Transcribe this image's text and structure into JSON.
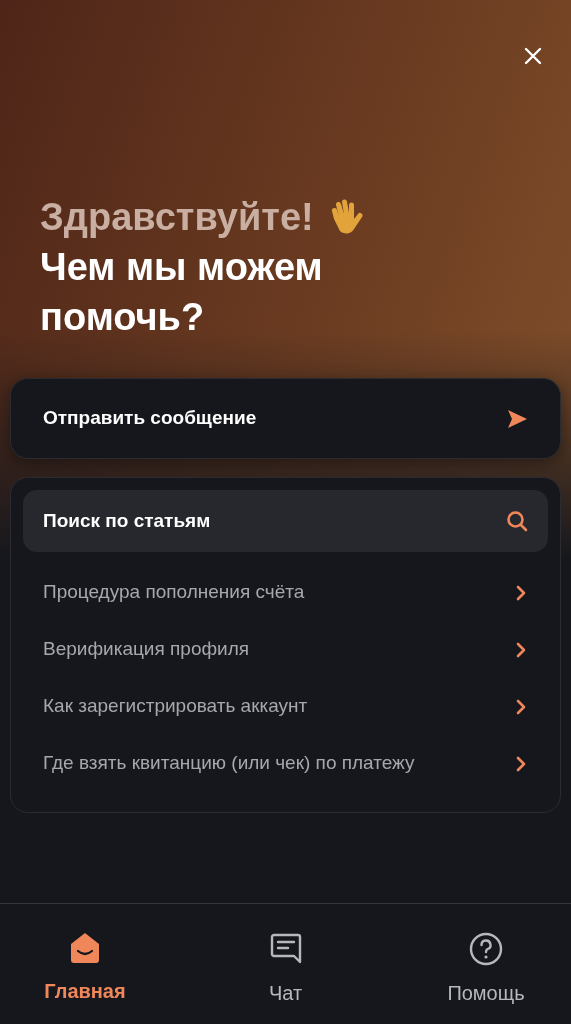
{
  "greeting": "Здравствуйте!",
  "heading": "Чем мы можем помочь?",
  "send_message": {
    "label": "Отправить сообщение"
  },
  "search": {
    "placeholder": "Поиск по статьям"
  },
  "articles": [
    {
      "title": "Процедура пополнения счёта"
    },
    {
      "title": "Верификация профиля"
    },
    {
      "title": "Как зарегистрировать аккаунт"
    },
    {
      "title": "Где взять квитанцию (или чек) по платежу"
    }
  ],
  "tabs": [
    {
      "label": "Главная",
      "kind": "home",
      "selected": true
    },
    {
      "label": "Чат",
      "kind": "chat",
      "selected": false
    },
    {
      "label": "Помощь",
      "kind": "help",
      "selected": false
    }
  ]
}
